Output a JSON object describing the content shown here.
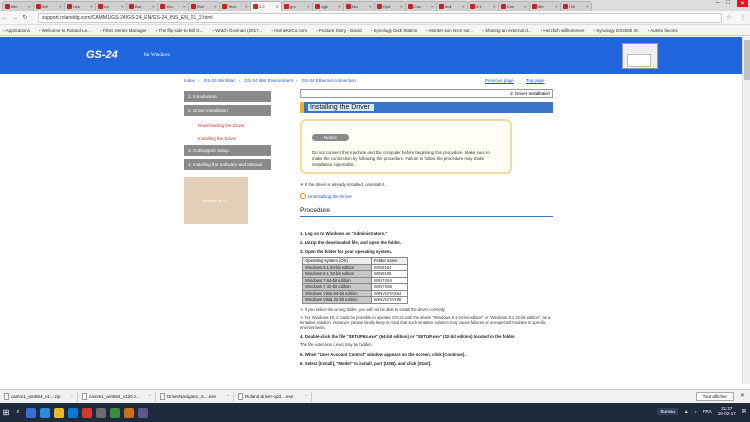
{
  "browser": {
    "tabs": [
      {
        "label": "Min"
      },
      {
        "label": "Wir"
      },
      {
        "label": "Lea"
      },
      {
        "label": "Lin"
      },
      {
        "label": "Bot"
      },
      {
        "label": "You"
      },
      {
        "label": "Roll"
      },
      {
        "label": "Tech"
      },
      {
        "label": "2.2",
        "active": true
      },
      {
        "label": "gro"
      },
      {
        "label": "cjgb"
      },
      {
        "label": "Ma"
      },
      {
        "label": "Opti"
      },
      {
        "label": "Con"
      },
      {
        "label": "Indi"
      },
      {
        "label": "3.1"
      },
      {
        "label": "Che"
      },
      {
        "label": "Me"
      },
      {
        "label": "ITA"
      }
    ],
    "url": "support.rolanddg.com/CAMM1/GS-24/GS-24_EN/GS-24_INS_EN_01_2.html",
    "bookmarks": [
      "Applications",
      "Welcome to Roland Le...",
      "Films Series Manager",
      "The flip side to Bill G...",
      "Watch Govinan (2017...",
      "HomeKitCo.com",
      "Feature Story - David",
      "Synology Disk Station",
      "Monter son NAS sur...",
      "Sharing an external d...",
      "Herzlich willkommen",
      "Synology DS408b Im",
      "Autres favoris"
    ]
  },
  "header": {
    "logo": "GS-24",
    "subtitle": "for Windows"
  },
  "breadcrumb": {
    "items": [
      "Index",
      "GS-24 Win/Mac",
      "GS-24 Win Environment",
      "GS-24 Ethernet connection"
    ]
  },
  "pagenav": {
    "prev": "Previous page",
    "top": "Top page"
  },
  "section_label": "2. Driver Installation",
  "sidebar": {
    "items": [
      {
        "label": "1. Introduction"
      },
      {
        "label": "2. Driver Installation"
      }
    ],
    "subitems": [
      {
        "label": "Downloading the Driver"
      },
      {
        "label": "Installing the Driver"
      }
    ],
    "items2": [
      {
        "label": "3. CutSupport Setup"
      },
      {
        "label": "4. Installing the Software and Manual"
      }
    ],
    "banner": "Want to fix it ..."
  },
  "main": {
    "heading": "Installing the Driver",
    "notice": {
      "badge": "Notice",
      "text": "Do not connect this machine and the computer before beginning this procedure. Make sure to make the connection by following the procedure. Failure to follow the procedure may make installation impossible."
    },
    "already": "✳ If the driver is already installed, uninstall it.",
    "uninstall_link": "Uninstalling the Driver",
    "procedure": "Procedure",
    "steps": [
      "1. Log on to Windows as \"Administrators.\"",
      "2. Unzip the downloaded file, and open the folder.",
      "3. Open the folder for your operating system."
    ],
    "table": {
      "headers": [
        "Operating system (OS)",
        "Folder name"
      ],
      "rows": [
        [
          "Windows 8.1 64-bit edition",
          "WIN8164"
        ],
        [
          "Windows 8.1 32-bit edition",
          "WIN8186"
        ],
        [
          "Windows 7 64-bit edition",
          "WIN7X64"
        ],
        [
          "Windows 7 32-bit edition",
          "WIN7X86"
        ],
        [
          "Windows Vista 64-bit edition",
          "WINVISTAX64"
        ],
        [
          "Windows Vista 32-bit edition",
          "WINVISTAX86"
        ]
      ]
    },
    "note1": "✳ If you select the wrong folder, you will not be able to install the driver correctly.",
    "note2": "✳ For Windows 10, it could be possible to operate GS-24 with the above \"Windows 8.1 64-bit edition\" or \"Windows 8.1 32-bit edition\", as a tentative solution. However, please kindly keep in mind that such tentative solution may cause failures or unexpected troubles in specific environments.",
    "step4": "4. Double-click the file \"SETUP64.exe\" (64-bit edition) or \"SETUP.exe\" (32-bit edition) located in the folder.",
    "note3": "The file extension (.exe) may be hidden.",
    "step5": "5. When \"User Account Control\" window appears on the screen, click [Continue].",
    "step6": "6. Select [Install], \"Model\" to install, port (USB), and click [Start]."
  },
  "downloads": {
    "items": [
      "camm1_win864_v1....zip",
      "camm1_win864_v120.z...",
      "DriverNavigator_S....exe",
      "Roland-driver-upd....exe"
    ],
    "show_all": "Tout afficher"
  },
  "taskbar": {
    "bureau": "Bureau",
    "lang": "FRA",
    "time": "21:27",
    "date": "18-02-17"
  },
  "colors": {
    "header_blue": "#2266dd",
    "sidebar_grey": "#8a8a8a",
    "notice_border": "#f2dc97",
    "heading_blue": "#3a74c9",
    "heading_accent": "#f2b022"
  }
}
